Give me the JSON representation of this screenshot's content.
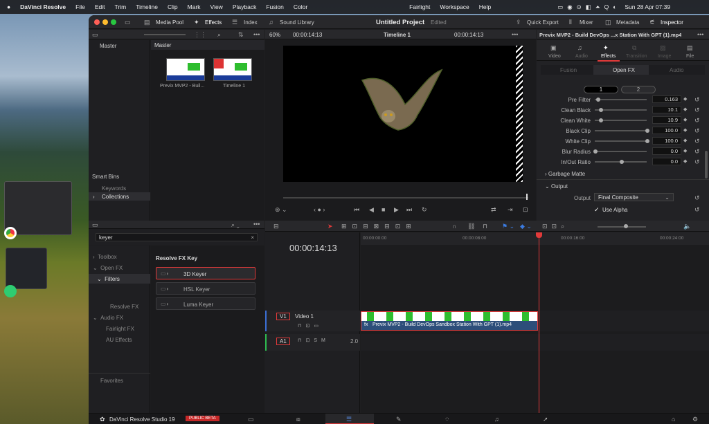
{
  "menubar": {
    "app": "DaVinci Resolve",
    "items": [
      "File",
      "Edit",
      "Trim",
      "Timeline",
      "Clip",
      "Mark",
      "View",
      "Playback",
      "Fusion",
      "Color"
    ],
    "right_items": [
      "Fairlight",
      "Workspace",
      "Help"
    ],
    "clock": "Sun 28 Apr  07:39"
  },
  "toolbar": {
    "media_pool": "Media Pool",
    "effects": "Effects",
    "index": "Index",
    "sound_library": "Sound Library",
    "project": "Untitled Project",
    "edited": "Edited",
    "quick_export": "Quick Export",
    "mixer": "Mixer",
    "metadata": "Metadata",
    "inspector": "Inspector"
  },
  "viewer_bar": {
    "zoom": "60%",
    "timecode": "00:00:14:13",
    "timeline": "Timeline 1",
    "timecode2": "00:00:14:13"
  },
  "inspector_title": "Previx MVP2 - Build DevOps ...x Station  With GPT (1).mp4",
  "inspector_tabs": [
    "Video",
    "Audio",
    "Effects",
    "Transition",
    "Image",
    "File"
  ],
  "inspector_subtabs": [
    "Fusion",
    "Open FX",
    "Audio"
  ],
  "keyer_tabs": [
    "1",
    "2"
  ],
  "params": [
    {
      "label": "Pre Filter",
      "value": "0.163",
      "pos": 0.05
    },
    {
      "label": "Clean Black",
      "value": "10.1",
      "pos": 0.1
    },
    {
      "label": "Clean White",
      "value": "10.9",
      "pos": 0.11
    },
    {
      "label": "Black Clip",
      "value": "100.0",
      "pos": 1.0
    },
    {
      "label": "White Clip",
      "value": "100.0",
      "pos": 1.0
    },
    {
      "label": "Blur Radius",
      "value": "0.0",
      "pos": 0.0
    },
    {
      "label": "In/Out Ratio",
      "value": "0.0",
      "pos": 0.5
    }
  ],
  "garbage_matte": "Garbage Matte",
  "output_section": "Output",
  "output_label": "Output",
  "output_value": "Final Composite",
  "use_alpha": "Use Alpha",
  "media_pool": {
    "master": "Master",
    "master_header": "Master",
    "clips": [
      "Previx MVP2 - Buil...",
      "Timeline 1"
    ],
    "smart_bins": "Smart Bins",
    "keywords": "Keywords",
    "collections": "Collections"
  },
  "effects": {
    "search": "keyer",
    "tree": [
      "Toolbox",
      "Open FX",
      "Filters",
      "Resolve FX",
      "Audio FX",
      "Fairlight FX",
      "AU Effects"
    ],
    "favorites": "Favorites",
    "category": "Resolve FX Key",
    "items": [
      "3D Keyer",
      "HSL Keyer",
      "Luma Keyer"
    ]
  },
  "timeline": {
    "timecode": "00:00:14:13",
    "ruler": [
      "00:00:00:00",
      "00:00:08:00",
      "00:00:16:00",
      "00:00:24:00"
    ],
    "v1": "V1",
    "video1": "Video 1",
    "a1": "A1",
    "a1_level": "2.0",
    "clip_name": "Previx MVP2 - Build DevOps Sandbox Station  With GPT (1).mp4"
  },
  "footer": {
    "brand": "DaVinci Resolve Studio 19",
    "beta": "PUBLIC BETA"
  },
  "colors": {
    "accent_red": "#e23a3a",
    "clip_blue": "#2d4e7a",
    "dock_active": "#3b6fd6"
  }
}
